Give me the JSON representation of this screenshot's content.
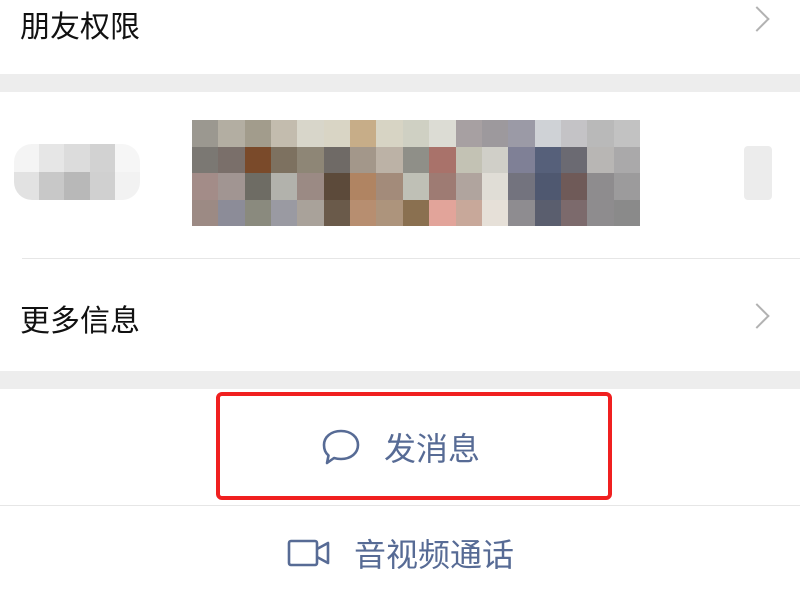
{
  "rows": {
    "friend_permissions": "朋友权限",
    "more_info": "更多信息"
  },
  "actions": {
    "send_message": "发消息",
    "video_call": "音视频通话"
  },
  "icons": {
    "message": "speech-bubble-icon",
    "video": "video-camera-icon",
    "chevron": "chevron-right-icon"
  },
  "colors": {
    "action_text": "#576b95",
    "highlight_border": "#f02020",
    "section_gap": "#ededed"
  }
}
